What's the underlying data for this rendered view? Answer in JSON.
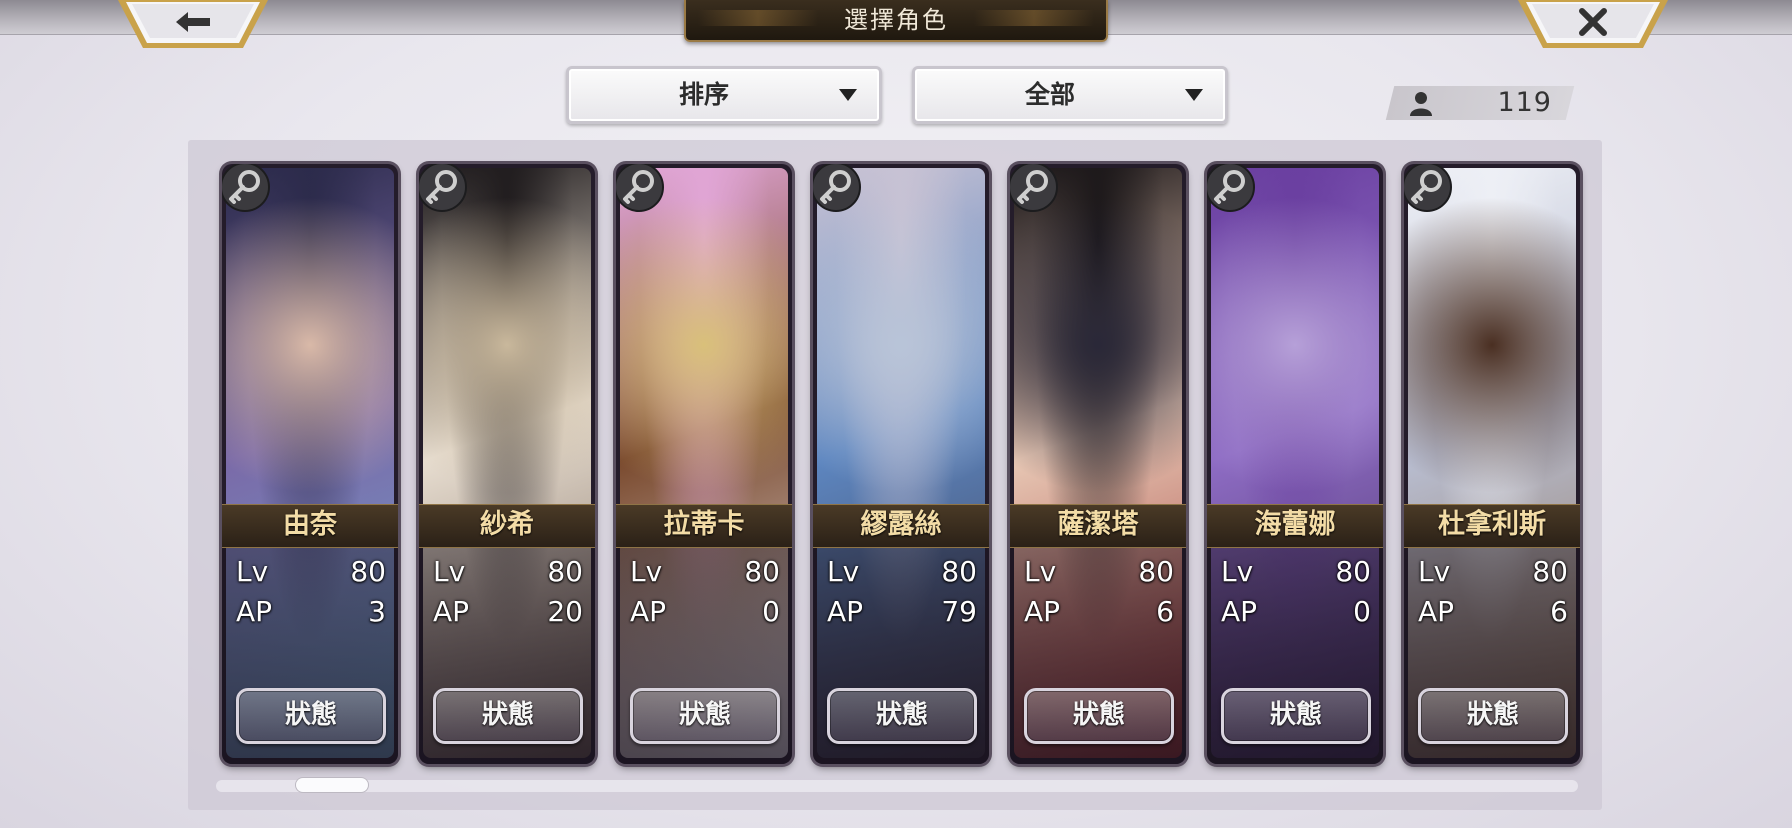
{
  "header": {
    "title": "選擇角色",
    "back_icon": "back-arrow-icon",
    "close_icon": "close-x-icon"
  },
  "toolbar": {
    "sort_label": "排序",
    "filter_label": "全部",
    "count_icon": "person-icon",
    "count": "119"
  },
  "characters": [
    {
      "name": "由奈",
      "lv_label": "Lv",
      "lv": "80",
      "ap_label": "AP",
      "ap": "3",
      "button": "狀態",
      "colors": [
        "#2b2a4a",
        "#7a6aa8",
        "#d9b9a8",
        "#6fa8d0"
      ]
    },
    {
      "name": "紗希",
      "lv_label": "Lv",
      "lv": "80",
      "ap_label": "AP",
      "ap": "20",
      "button": "狀態",
      "colors": [
        "#1e1a1c",
        "#e7ddd0",
        "#c9b89c",
        "#6d5a4e"
      ]
    },
    {
      "name": "拉蒂卡",
      "lv_label": "Lv",
      "lv": "80",
      "ap_label": "AP",
      "ap": "0",
      "button": "狀態",
      "colors": [
        "#e2a7d8",
        "#7a4a2e",
        "#d9c07a",
        "#f1eef4"
      ]
    },
    {
      "name": "繆露絲",
      "lv_label": "Lv",
      "lv": "80",
      "ap_label": "AP",
      "ap": "79",
      "button": "狀態",
      "colors": [
        "#c9c3d4",
        "#5d86c0",
        "#b8c4d8",
        "#3a3342"
      ]
    },
    {
      "name": "薩潔塔",
      "lv_label": "Lv",
      "lv": "80",
      "ap_label": "AP",
      "ap": "6",
      "button": "狀態",
      "colors": [
        "#1a1618",
        "#e7c7b4",
        "#2a2838",
        "#9a2a2a"
      ]
    },
    {
      "name": "海蕾娜",
      "lv_label": "Lv",
      "lv": "80",
      "ap_label": "AP",
      "ap": "0",
      "button": "狀態",
      "colors": [
        "#6a3fa0",
        "#8e6cc4",
        "#b6a0d8",
        "#3c2856"
      ]
    },
    {
      "name": "杜拿利斯",
      "lv_label": "Lv",
      "lv": "80",
      "ap_label": "AP",
      "ap": "6",
      "button": "狀態",
      "colors": [
        "#eef0f6",
        "#b8bdd0",
        "#4a2f22",
        "#8a6a4a"
      ]
    }
  ],
  "theme": {
    "accent_gold": "#f3dca6",
    "plate_dark": "#2b2117"
  }
}
